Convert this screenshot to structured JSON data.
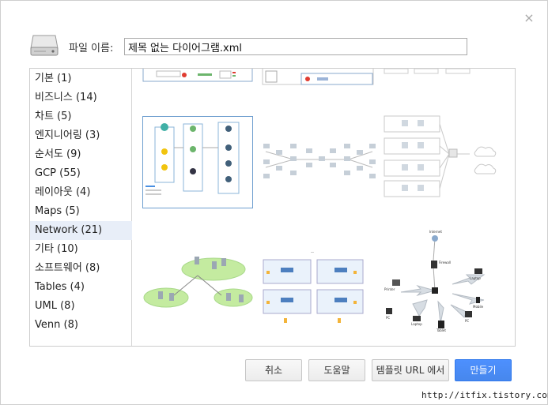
{
  "dialog": {
    "close_glyph": "×",
    "filename_label": "파일 이름:",
    "filename_value": "제목 없는 다이어그램.xml"
  },
  "categories": [
    {
      "label": "기본 (1)"
    },
    {
      "label": "비즈니스 (14)"
    },
    {
      "label": "차트 (5)"
    },
    {
      "label": "엔지니어링 (3)"
    },
    {
      "label": "순서도 (9)"
    },
    {
      "label": "GCP (55)"
    },
    {
      "label": "레이아웃 (4)"
    },
    {
      "label": "Maps (5)"
    },
    {
      "label": "Network (21)"
    },
    {
      "label": "기타 (10)"
    },
    {
      "label": "소프트웨어 (8)"
    },
    {
      "label": "Tables (4)"
    },
    {
      "label": "UML (8)"
    },
    {
      "label": "Venn (8)"
    }
  ],
  "selected_category": "Network (21)",
  "thumbnail_labels": {
    "internet": "Internet",
    "firewall": "Firewall",
    "printer": "Printer",
    "laptop": "Laptop",
    "mobile": "Mobile",
    "pc": "PC",
    "tablet": "Tablet"
  },
  "buttons": {
    "cancel": "취소",
    "help": "도움말",
    "template_url": "템플릿 URL 에서",
    "create": "만들기"
  },
  "footer_url": "http://itfix.tistory.com",
  "colors": {
    "primary": "#4d90fe",
    "selected_bg": "#e8eef8",
    "border": "#cdcdcd"
  }
}
